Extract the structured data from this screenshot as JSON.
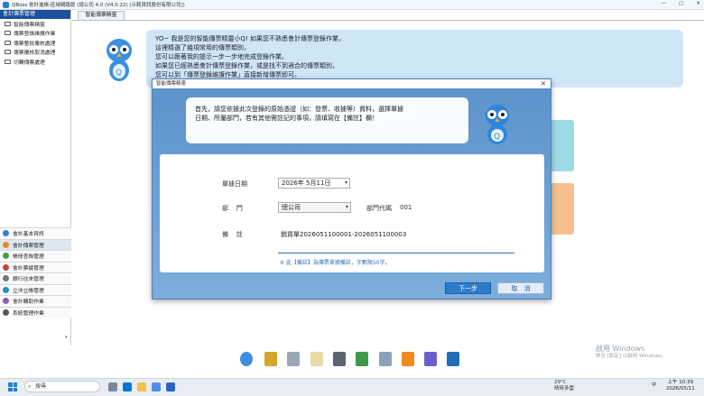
{
  "window": {
    "title": "QBoss 會計進帳-區域網路版 (總公司 4.0 (V4.0.22) [示範資訊股份有限公司])",
    "controls": [
      "—",
      "□",
      "✕"
    ]
  },
  "left_panel": {
    "header": "會計傳票管理",
    "tree_items": [
      "智能傳票精靈",
      "傳票登錄維護作業",
      "傳票整批覆核處理",
      "傳票覆核取消處理",
      "切轉傳票處理"
    ],
    "modules": [
      "會計基本資訊",
      "會計傳票管理",
      "帳冊查詢管理",
      "會計票據管理",
      "銀行往來管理",
      "立沖立帳管理",
      "會計輔助作業",
      "系統管理作業"
    ],
    "active_module_index": 1
  },
  "tab": {
    "label": "智能傳票精靈"
  },
  "assistant": {
    "message": "YO~ 我是您的智能傳票精靈小Q! 如果您不熟悉會計傳票登錄作業，\n這裡精選了幾項常用的傳票類別，\n您可以跟著我的提示一步一步地完成登錄作業。\n如果您已經熟悉會計傳票登錄作業，或是找不到適合的傳票類別，\n您可以到「傳票登錄維護作業」直接新增傳票即可。"
  },
  "dialog": {
    "title": "智能傳票精靈",
    "close": "✕",
    "message": "首先，請您依據此次登錄的原始憑證（如：發票、收據等）資料，選擇單據\n日期、所屬部門，若有其他需註記的事項，請填寫在【備註】欄！",
    "form": {
      "date_label": "單據日期",
      "date_value": "2026年  5月11日",
      "dept_label": "部    門",
      "dept_value": "總公司",
      "dept_code_label": "部門代碼",
      "dept_code_value": "001",
      "note_label": "備    註",
      "note_value": "銷貨單2026051100001-2026051100003",
      "hint": "※ 此【備註】為傳票單據備註，字數限50字。"
    },
    "buttons": {
      "next": "下一步",
      "cancel": "取　消"
    }
  },
  "watermark": {
    "line1": "啟用 Windows",
    "line2": "移至 [設定] 以啟用 Windows。"
  },
  "dock_icons": [
    "mascot-icon",
    "scale-icon",
    "check-icon",
    "document-icon",
    "bank-icon",
    "recycle-icon",
    "folder-icon",
    "book-icon",
    "q-icon",
    "calculator-icon"
  ],
  "taskbar": {
    "search_placeholder": "搜尋",
    "weather_temp": "29°C",
    "weather_desc": "晴時多雲",
    "lang": "中",
    "time": "上午 10:39",
    "date": "2026/05/11"
  },
  "colors": {
    "accent": "#1c4f9c",
    "dialog_bg": "#6b9fd0",
    "bubble": "#cfe6f7",
    "primary_button": "#2e7bcc"
  }
}
